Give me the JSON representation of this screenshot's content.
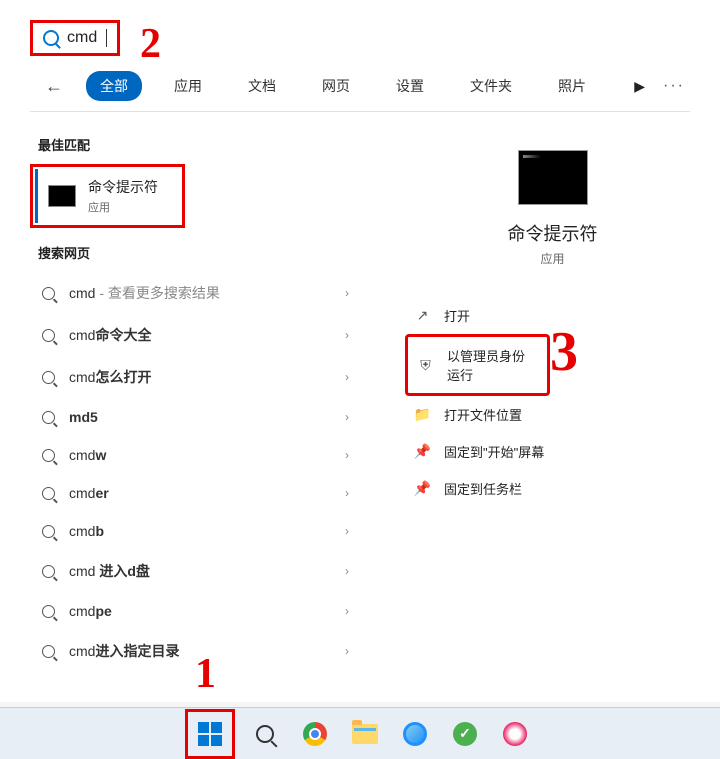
{
  "search": {
    "value": "cmd"
  },
  "nav": {
    "tabs": [
      "全部",
      "应用",
      "文档",
      "网页",
      "设置",
      "文件夹",
      "照片"
    ]
  },
  "sections": {
    "best": "最佳匹配",
    "web": "搜索网页"
  },
  "best_match": {
    "title": "命令提示符",
    "sub": "应用"
  },
  "results": [
    {
      "prefix": "cmd",
      "suffix": " - 查看更多搜索结果",
      "bold": false
    },
    {
      "prefix": "cmd",
      "suffix": "命令大全",
      "bold": true
    },
    {
      "prefix": "cmd",
      "suffix": "怎么打开",
      "bold": true
    },
    {
      "prefix": "",
      "suffix": "md5",
      "bold": true
    },
    {
      "prefix": "cmd",
      "suffix": "w",
      "bold": true
    },
    {
      "prefix": "cmd",
      "suffix": "er",
      "bold": true
    },
    {
      "prefix": "cmd",
      "suffix": "b",
      "bold": true
    },
    {
      "prefix": "cmd ",
      "suffix": "进入d盘",
      "bold": true
    },
    {
      "prefix": "cmd",
      "suffix": "pe",
      "bold": true
    },
    {
      "prefix": "cmd",
      "suffix": "进入指定目录",
      "bold": true
    }
  ],
  "preview": {
    "title": "命令提示符",
    "sub": "应用"
  },
  "actions": [
    {
      "icon": "↗",
      "label": "打开"
    },
    {
      "icon": "⛨",
      "label": "以管理员身份运行"
    },
    {
      "icon": "📁",
      "label": "打开文件位置"
    },
    {
      "icon": "📌",
      "label": "固定到\"开始\"屏幕"
    },
    {
      "icon": "📌",
      "label": "固定到任务栏"
    }
  ],
  "annotations": {
    "a1": "1",
    "a2": "2",
    "a3": "3"
  }
}
